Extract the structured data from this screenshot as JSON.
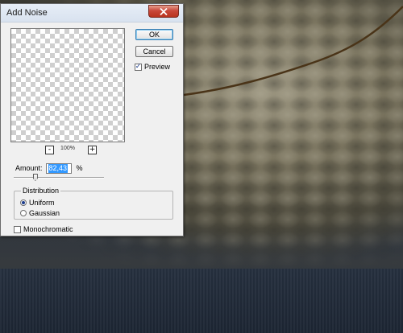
{
  "dialog": {
    "title": "Add Noise",
    "zoom_level": "100%",
    "zoom_out": "-",
    "zoom_in": "+",
    "ok_label": "OK",
    "cancel_label": "Cancel",
    "preview_label": "Preview",
    "preview_checked": true,
    "amount_label": "Amount:",
    "amount_value": "82,43",
    "amount_unit": "%",
    "amount_slider_fraction": 0.24,
    "distribution_label": "Distribution",
    "distribution_options": [
      "Uniform",
      "Gaussian"
    ],
    "distribution_selected": "Uniform",
    "monochromatic_label": "Monochromatic",
    "monochromatic_checked": false
  },
  "icons": {
    "close": "close-icon",
    "check": "check-icon"
  },
  "colors": {
    "close_button": "#c9473a",
    "selection": "#3399ff",
    "dialog_bg": "#f0f0f0"
  }
}
